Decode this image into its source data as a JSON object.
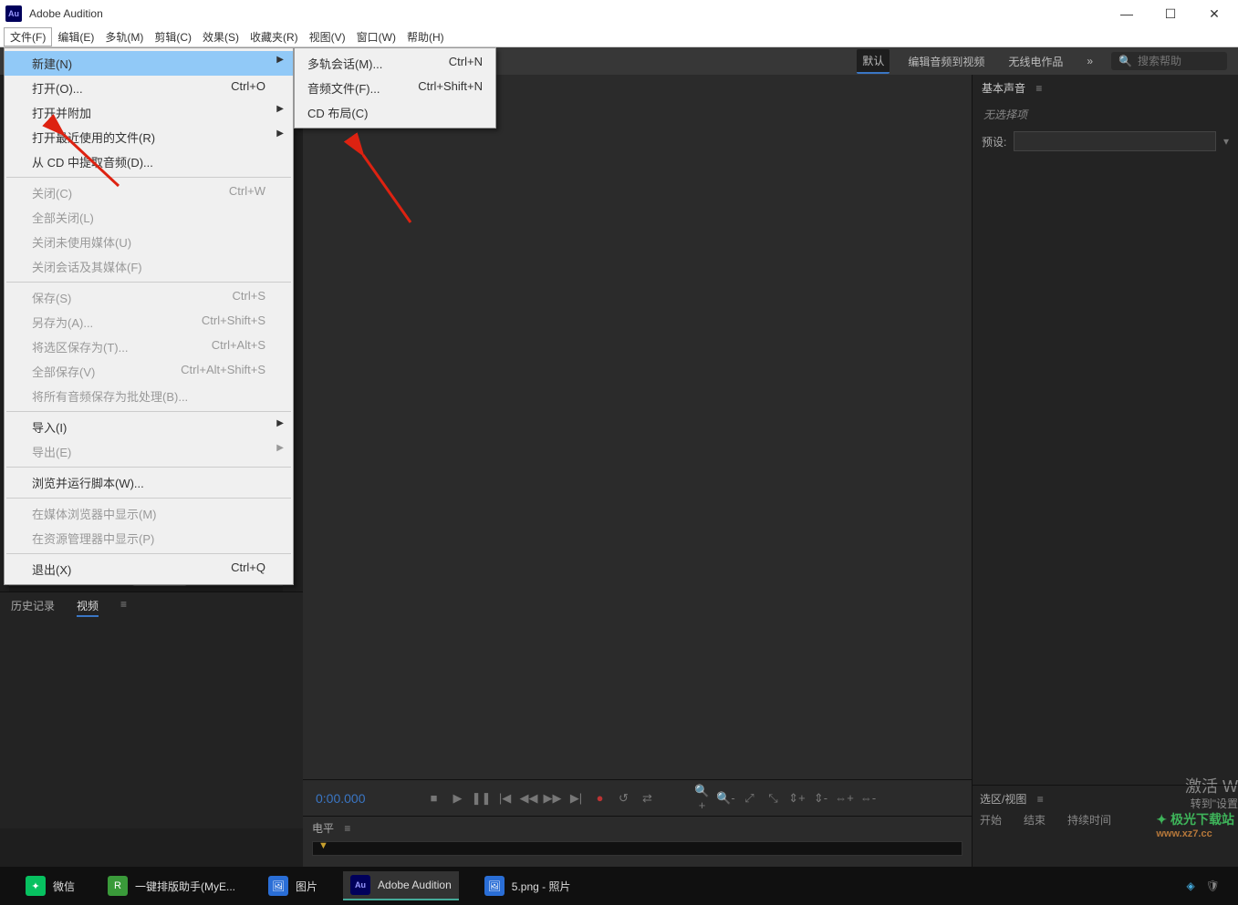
{
  "app": {
    "title": "Adobe Audition",
    "icon_label": "Au"
  },
  "menubar": [
    "文件(F)",
    "编辑(E)",
    "多轨(M)",
    "剪辑(C)",
    "效果(S)",
    "收藏夹(R)",
    "视图(V)",
    "窗口(W)",
    "帮助(H)"
  ],
  "file_menu": {
    "items": [
      {
        "label": "新建(N)",
        "shortcut": "",
        "has_sub": true,
        "highlight": true
      },
      {
        "label": "打开(O)...",
        "shortcut": "Ctrl+O"
      },
      {
        "label": "打开并附加",
        "shortcut": "",
        "has_sub": true
      },
      {
        "label": "打开最近使用的文件(R)",
        "shortcut": "",
        "has_sub": true
      },
      {
        "label": "从 CD 中提取音频(D)...",
        "shortcut": ""
      },
      {
        "sep": true
      },
      {
        "label": "关闭(C)",
        "shortcut": "Ctrl+W",
        "disabled": true
      },
      {
        "label": "全部关闭(L)",
        "shortcut": "",
        "disabled": true
      },
      {
        "label": "关闭未使用媒体(U)",
        "shortcut": "",
        "disabled": true
      },
      {
        "label": "关闭会话及其媒体(F)",
        "shortcut": "",
        "disabled": true
      },
      {
        "sep": true
      },
      {
        "label": "保存(S)",
        "shortcut": "Ctrl+S",
        "disabled": true
      },
      {
        "label": "另存为(A)...",
        "shortcut": "Ctrl+Shift+S",
        "disabled": true
      },
      {
        "label": "将选区保存为(T)...",
        "shortcut": "Ctrl+Alt+S",
        "disabled": true
      },
      {
        "label": "全部保存(V)",
        "shortcut": "Ctrl+Alt+Shift+S",
        "disabled": true
      },
      {
        "label": "将所有音频保存为批处理(B)...",
        "shortcut": "",
        "disabled": true
      },
      {
        "sep": true
      },
      {
        "label": "导入(I)",
        "shortcut": "",
        "has_sub": true
      },
      {
        "label": "导出(E)",
        "shortcut": "",
        "has_sub": true,
        "disabled": true
      },
      {
        "sep": true
      },
      {
        "label": "浏览并运行脚本(W)...",
        "shortcut": ""
      },
      {
        "sep": true
      },
      {
        "label": "在媒体浏览器中显示(M)",
        "shortcut": "",
        "disabled": true
      },
      {
        "label": "在资源管理器中显示(P)",
        "shortcut": "",
        "disabled": true
      },
      {
        "sep": true
      },
      {
        "label": "退出(X)",
        "shortcut": "Ctrl+Q"
      }
    ]
  },
  "new_submenu": [
    {
      "label": "多轨会话(M)...",
      "shortcut": "Ctrl+N"
    },
    {
      "label": "音频文件(F)...",
      "shortcut": "Ctrl+Shift+N"
    },
    {
      "label": "CD 布局(C)",
      "shortcut": ""
    }
  ],
  "workspaces": {
    "items": [
      "默认",
      "编辑音频到视频",
      "无线电作品"
    ],
    "more": "»",
    "search_placeholder": "搜索帮助"
  },
  "right_panel": {
    "title": "基本声音",
    "no_selection": "无选择项",
    "preset_label": "预设:"
  },
  "history": {
    "tabs": [
      "历史记录",
      "视频"
    ]
  },
  "transport": {
    "timecode": "0:00.000"
  },
  "level_panel": {
    "title": "电平"
  },
  "selection_panel": {
    "title": "选区/视图",
    "cols": [
      "开始",
      "结束",
      "持续时间"
    ]
  },
  "watermark": {
    "line1": "激活 W",
    "line2": "转到\"设置"
  },
  "site": {
    "name": "极光下载站",
    "url": "www.xz7.cc"
  },
  "taskbar": {
    "items": [
      {
        "icon": "wechat",
        "label": "微信"
      },
      {
        "icon": "app1",
        "label": "一键排版助手(MyE..."
      },
      {
        "icon": "photos",
        "label": "图片"
      },
      {
        "icon": "audition",
        "label": "Adobe Audition",
        "active": true
      },
      {
        "icon": "photos2",
        "label": "5.png - 照片"
      }
    ]
  }
}
